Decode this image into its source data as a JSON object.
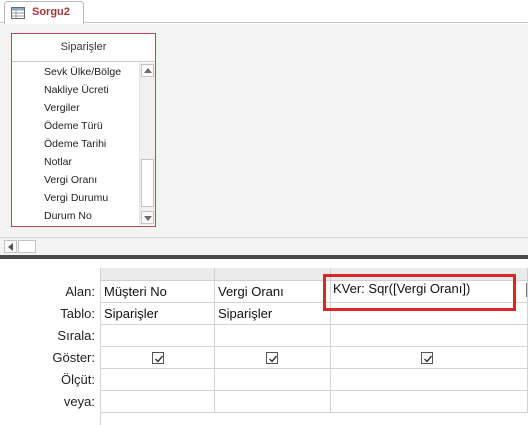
{
  "tab": {
    "label": "Sorgu2",
    "icon": "query-icon"
  },
  "table_box": {
    "title": "Siparişler",
    "fields": [
      "Sevk Ülke/Bölge",
      "Nakliye Ücreti",
      "Vergiler",
      "Ödeme Türü",
      "Ödeme Tarihi",
      "Notlar",
      "Vergi Oranı",
      "Vergi Durumu",
      "Durum No"
    ]
  },
  "grid": {
    "row_labels": [
      "Alan:",
      "Tablo:",
      "Sırala:",
      "Göster:",
      "Ölçüt:",
      "veya:"
    ],
    "columns": [
      {
        "field": "Müşteri No",
        "table": "Siparişler",
        "show": true
      },
      {
        "field": "Vergi Oranı",
        "table": "Siparişler",
        "show": true
      },
      {
        "field": "KVer: Sqr([Vergi Oranı])",
        "table": "",
        "show": true,
        "highlighted": true
      }
    ]
  },
  "colors": {
    "tab_text": "#a4373a",
    "table_border": "#b5495b",
    "highlight_border": "#e0242b",
    "splitter": "#4a4a4a"
  }
}
